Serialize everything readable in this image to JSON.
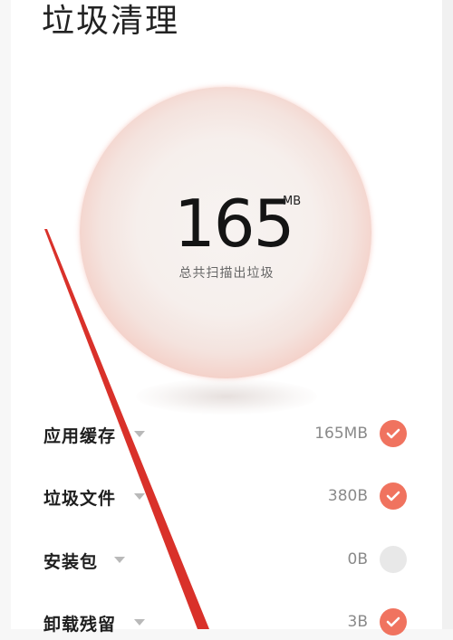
{
  "header": {
    "title": "垃圾清理"
  },
  "summary": {
    "value": "165",
    "unit": "MB",
    "caption": "总共扫描出垃圾"
  },
  "items": [
    {
      "label": "应用缓存",
      "size": "165MB",
      "checked": true
    },
    {
      "label": "垃圾文件",
      "size": "380B",
      "checked": true
    },
    {
      "label": "安装包",
      "size": "0B",
      "checked": false
    },
    {
      "label": "卸载残留",
      "size": "3B",
      "checked": true
    }
  ],
  "icons": {
    "expand": "chevron-down-icon",
    "check": "checkmark-icon"
  },
  "colors": {
    "accent": "#f0735f",
    "unchecked": "#e8e8e8",
    "annotation_line": "#d9312a"
  }
}
